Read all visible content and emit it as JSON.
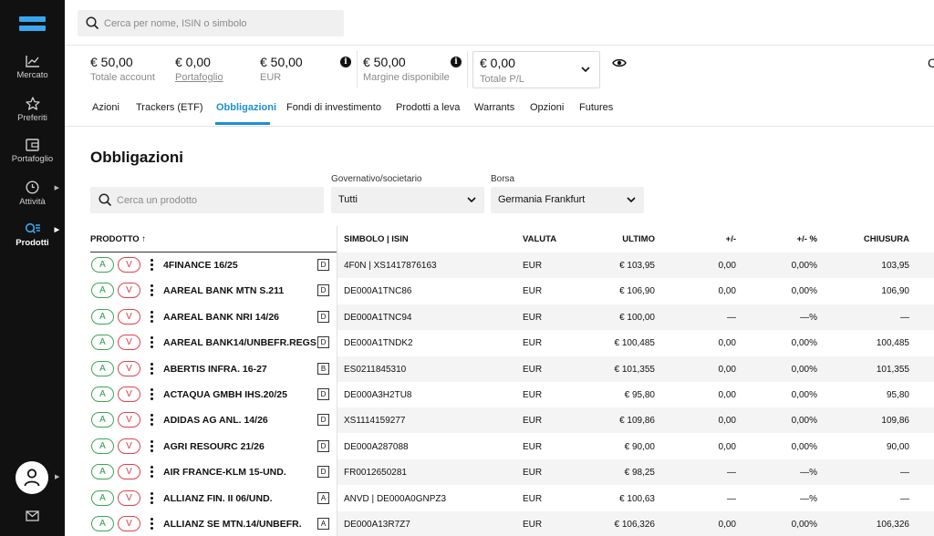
{
  "search": {
    "placeholder": "Cerca per nome, ISIN o simbolo"
  },
  "sidebar": {
    "items": [
      {
        "label": "Mercato",
        "icon": "chart-line-icon"
      },
      {
        "label": "Preferiti",
        "icon": "star-icon"
      },
      {
        "label": "Portafoglio",
        "icon": "wallet-icon"
      },
      {
        "label": "Attività",
        "icon": "clock-icon"
      },
      {
        "label": "Prodotti",
        "icon": "products-search-icon"
      }
    ],
    "active": "Prodotti",
    "accent": "#3aa6ef"
  },
  "balances": {
    "total": {
      "value": "€ 50,00",
      "label": "Totale account"
    },
    "portfolio": {
      "value": "€ 0,00",
      "label": "Portafoglio"
    },
    "eur": {
      "value": "€ 50,00",
      "label": "EUR"
    },
    "margin": {
      "value": "€ 50,00",
      "label": "Margine disponibile"
    },
    "pl": {
      "value": "€ 0,00",
      "label": "Totale P/L"
    },
    "cut_text": "C"
  },
  "tabs": [
    "Azioni",
    "Trackers (ETF)",
    "Obbligazioni",
    "Fondi di investimento",
    "Prodotti a leva",
    "Warrants",
    "Opzioni",
    "Futures"
  ],
  "active_tab": "Obbligazioni",
  "page_title": "Obbligazioni",
  "filters": {
    "search_placeholder": "Cerca un prodotto",
    "type_label": "Governativo/societario",
    "type_value": "Tutti",
    "exchange_label": "Borsa",
    "exchange_value": "Germania Frankfurt"
  },
  "table": {
    "headers": {
      "product": "PRODOTTO ↑",
      "symbol": "SIMBOLO | ISIN",
      "currency": "VALUTA",
      "last": "ULTIMO",
      "change": "+/-",
      "change_pct": "+/- %",
      "close": "CHIUSURA"
    },
    "buy_label": "A",
    "sell_label": "V",
    "rows": [
      {
        "name": "4FINANCE 16/25",
        "badge": "D",
        "symbol": "4F0N | XS1417876163",
        "currency": "EUR",
        "last": "€ 103,95",
        "change": "0,00",
        "change_pct": "0,00%",
        "close": "103,95"
      },
      {
        "name": "AAREAL BANK MTN S.211",
        "badge": "D",
        "symbol": "DE000A1TNC86",
        "currency": "EUR",
        "last": "€ 106,90",
        "change": "0,00",
        "change_pct": "0,00%",
        "close": "106,90"
      },
      {
        "name": "AAREAL BANK NRI 14/26",
        "badge": "D",
        "symbol": "DE000A1TNC94",
        "currency": "EUR",
        "last": "€ 100,00",
        "change": "—",
        "change_pct": "—%",
        "close": "—"
      },
      {
        "name": "AAREAL BANK14/UNBEFR.REGS",
        "badge": "D",
        "symbol": "DE000A1TNDK2",
        "currency": "EUR",
        "last": "€ 100,485",
        "change": "0,00",
        "change_pct": "0,00%",
        "close": "100,485"
      },
      {
        "name": "ABERTIS INFRA. 16-27",
        "badge": "B",
        "symbol": "ES0211845310",
        "currency": "EUR",
        "last": "€ 101,355",
        "change": "0,00",
        "change_pct": "0,00%",
        "close": "101,355"
      },
      {
        "name": "ACTAQUA GMBH IHS.20/25",
        "badge": "D",
        "symbol": "DE000A3H2TU8",
        "currency": "EUR",
        "last": "€ 95,80",
        "change": "0,00",
        "change_pct": "0,00%",
        "close": "95,80"
      },
      {
        "name": "ADIDAS AG ANL. 14/26",
        "badge": "D",
        "symbol": "XS1114159277",
        "currency": "EUR",
        "last": "€ 109,86",
        "change": "0,00",
        "change_pct": "0,00%",
        "close": "109,86"
      },
      {
        "name": "AGRI RESOURC 21/26",
        "badge": "D",
        "symbol": "DE000A287088",
        "currency": "EUR",
        "last": "€ 90,00",
        "change": "0,00",
        "change_pct": "0,00%",
        "close": "90,00"
      },
      {
        "name": "AIR FRANCE-KLM 15-UND.",
        "badge": "D",
        "symbol": "FR0012650281",
        "currency": "EUR",
        "last": "€ 98,25",
        "change": "—",
        "change_pct": "—%",
        "close": "—"
      },
      {
        "name": "ALLIANZ FIN. II 06/UND.",
        "badge": "A",
        "symbol": "ANVD | DE000A0GNPZ3",
        "currency": "EUR",
        "last": "€ 100,63",
        "change": "—",
        "change_pct": "—%",
        "close": "—"
      },
      {
        "name": "ALLIANZ SE MTN.14/UNBEFR.",
        "badge": "A",
        "symbol": "DE000A13R7Z7",
        "currency": "EUR",
        "last": "€ 106,326",
        "change": "0,00",
        "change_pct": "0,00%",
        "close": "106,326"
      }
    ]
  },
  "colors": {
    "accent": "#1b8fd6",
    "buy": "#3aa655",
    "sell": "#e0424b",
    "sidebar": "#111111"
  }
}
